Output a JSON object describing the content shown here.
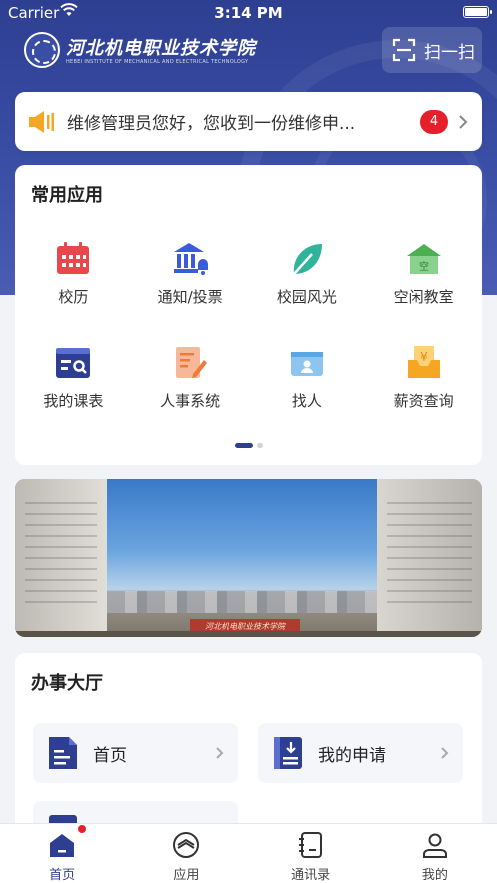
{
  "status_bar": {
    "carrier": "Carrier",
    "time": "3:14 PM"
  },
  "header": {
    "school_name": "河北机电职业技术学院",
    "school_name_en": "HEBEI INSTITUTE OF MECHANICAL AND ELECTRICAL TECHNOLOGY",
    "scan_label": "扫一扫"
  },
  "notice": {
    "message": "维修管理员您好，您收到一份维修申...",
    "badge_count": "4"
  },
  "common_apps": {
    "title": "常用应用",
    "items": [
      {
        "label": "校历",
        "icon": "calendar-icon",
        "color": "#e8474c"
      },
      {
        "label": "通知/投票",
        "icon": "building-bell-icon",
        "color": "#3b5bdb"
      },
      {
        "label": "校园风光",
        "icon": "leaf-icon",
        "color": "#2fb39a"
      },
      {
        "label": "空闲教室",
        "icon": "house-icon",
        "color": "#4caf50"
      },
      {
        "label": "我的课表",
        "icon": "schedule-icon",
        "color": "#2e3f91"
      },
      {
        "label": "人事系统",
        "icon": "document-edit-icon",
        "color": "#f07a3a"
      },
      {
        "label": "找人",
        "icon": "contact-card-icon",
        "color": "#5aa7e6"
      },
      {
        "label": "薪资查询",
        "icon": "salary-icon",
        "color": "#f5a623"
      }
    ],
    "page_indicator": {
      "pages": 2,
      "current": 1
    }
  },
  "banner": {
    "sign_text": "河北机电职业技术学院"
  },
  "service_hall": {
    "title": "办事大厅",
    "items": [
      {
        "label": "首页",
        "icon": "document-icon"
      },
      {
        "label": "我的申请",
        "icon": "download-document-icon"
      }
    ]
  },
  "tab_bar": {
    "items": [
      {
        "label": "首页",
        "icon": "home-icon",
        "active": true,
        "dot": true
      },
      {
        "label": "应用",
        "icon": "compass-icon",
        "active": false
      },
      {
        "label": "通讯录",
        "icon": "address-book-icon",
        "active": false
      },
      {
        "label": "我的",
        "icon": "person-icon",
        "active": false
      }
    ]
  },
  "colors": {
    "primary": "#2e3f91",
    "badge": "#e6202a",
    "background": "#f2f3f7"
  }
}
